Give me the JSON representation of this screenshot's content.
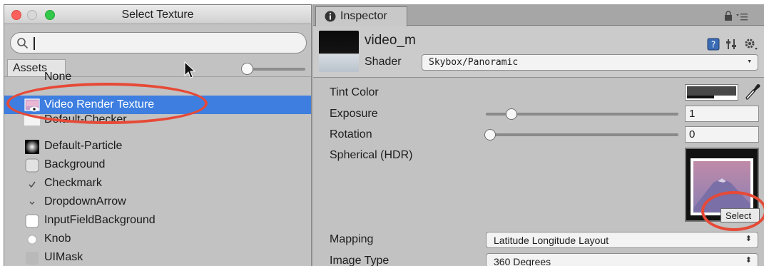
{
  "select_window": {
    "title": "Select Texture",
    "search": {
      "value": "",
      "placeholder": ""
    },
    "tab": "Assets",
    "items": [
      {
        "label": "None",
        "icon": "none"
      },
      {
        "label": "Video Render Texture",
        "icon": "render-texture-icon",
        "selected": true
      },
      {
        "label": "Default-Checker",
        "icon": "checker-icon"
      },
      {
        "label": "Default-Particle",
        "icon": "particle-icon"
      },
      {
        "label": "Background",
        "icon": "rounded-square-icon"
      },
      {
        "label": "Checkmark",
        "icon": "checkmark-icon"
      },
      {
        "label": "DropdownArrow",
        "icon": "dropdown-arrow-icon"
      },
      {
        "label": "InputFieldBackground",
        "icon": "input-field-icon"
      },
      {
        "label": "Knob",
        "icon": "knob-icon"
      },
      {
        "label": "UIMask",
        "icon": "mask-icon"
      }
    ]
  },
  "inspector": {
    "tab": "Inspector",
    "material_name": "video_m",
    "shader_label": "Shader",
    "shader_value": "Skybox/Panoramic",
    "props": {
      "tint_label": "Tint Color",
      "exposure_label": "Exposure",
      "exposure_value": "1",
      "rotation_label": "Rotation",
      "rotation_value": "0",
      "spherical_label": "Spherical  (HDR)",
      "select_button": "Select",
      "mapping_label": "Mapping",
      "mapping_value": "Latitude Longitude Layout",
      "image_type_label": "Image Type",
      "image_type_value": "360 Degrees"
    }
  },
  "colors": {
    "selection": "#3d7ee0",
    "annotation": "#e64a37",
    "panel": "#c2c2c2"
  }
}
